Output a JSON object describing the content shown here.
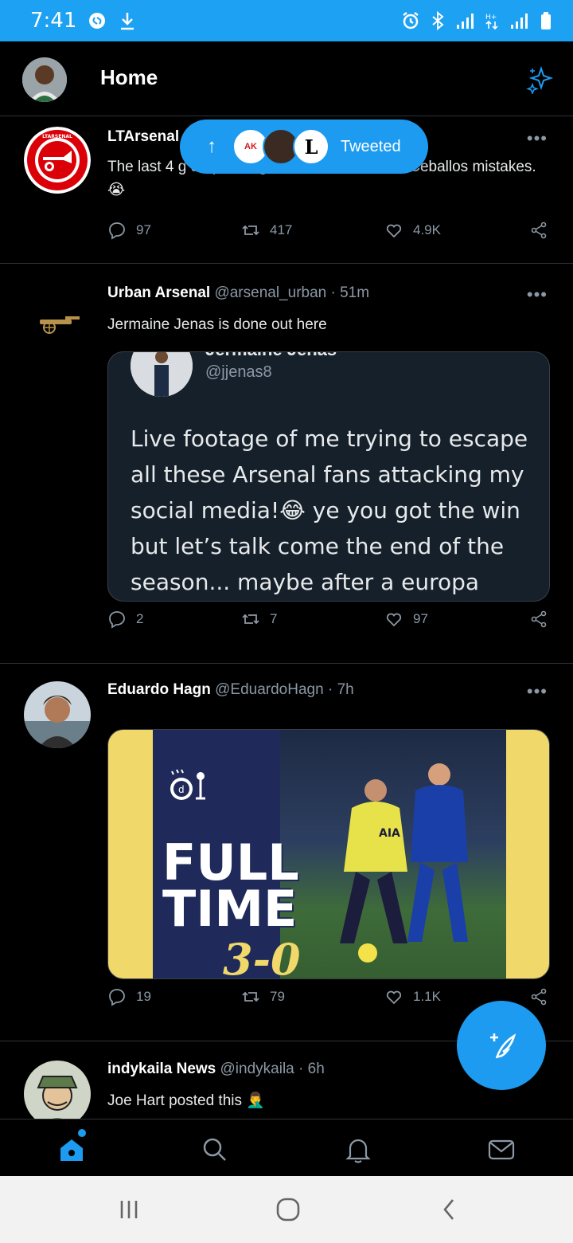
{
  "status_bar": {
    "time": "7:41",
    "icons": [
      "shazam-icon",
      "download-icon",
      "alarm-icon",
      "bluetooth-icon",
      "signal-icon",
      "data-arrows-icon",
      "signal-icon",
      "battery-icon"
    ],
    "color": "#1da1f2"
  },
  "header": {
    "title": "Home",
    "sparkle_icon": "sparkle-icon"
  },
  "new_tweets_pill": {
    "label": "Tweeted",
    "avatars": [
      "AK",
      "",
      "L"
    ]
  },
  "tweets": [
    {
      "name": "LTArsenal",
      "handle": "",
      "time": "",
      "text": "The last 4 g                                                    uropa League have been due to Ceballos mistakes. 😭",
      "replies": "97",
      "retweets": "417",
      "likes": "4.9K"
    },
    {
      "name": "Urban Arsenal",
      "handle": "@arsenal_urban",
      "time": "51m",
      "text": "Jermaine Jenas is done out here",
      "quote": {
        "name": "Jermaine Jenas",
        "handle": "@jjenas8",
        "text": "Live footage of me trying to escape all these Arsenal fans attacking my social media!😂 ye you got the win but let’s talk come the end of the season... maybe after a europa"
      },
      "replies": "2",
      "retweets": "7",
      "likes": "97"
    },
    {
      "name": "Eduardo Hagn",
      "handle": "@EduardoHagn",
      "time": "7h",
      "media": {
        "headline_line1": "FULL",
        "headline_line2": "TIME",
        "score": "3-0",
        "shirt_text": "AIA"
      },
      "replies": "19",
      "retweets": "79",
      "likes": "1.1K"
    },
    {
      "name": "indykaila News",
      "handle": "@indykaila",
      "time": "6h",
      "text": "Joe Hart posted this 🤦‍♂️"
    }
  ],
  "tabbar": {
    "tabs": [
      "home-icon",
      "search-icon",
      "bell-icon",
      "mail-icon"
    ],
    "active": "home-icon"
  },
  "android_nav": [
    "recents-icon",
    "home-circle-icon",
    "back-icon"
  ],
  "colors": {
    "accent": "#1d9bf0",
    "background": "#000000",
    "secondary_text": "#8b98a5",
    "divider": "#2f3336"
  }
}
